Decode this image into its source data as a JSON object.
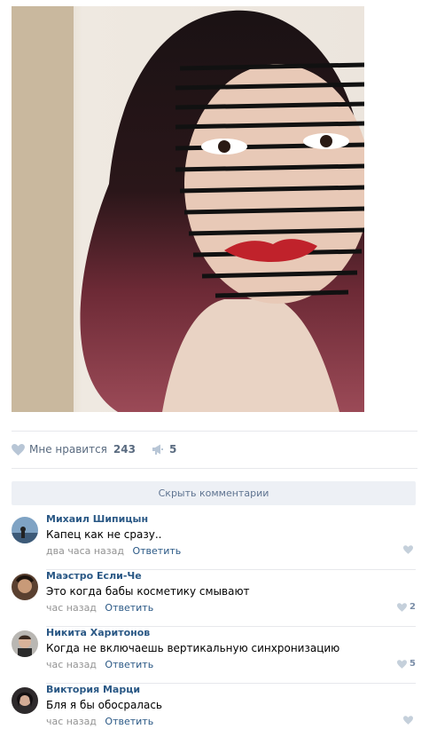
{
  "post": {
    "image": {
      "subject": "optical-illusion-face-makeup"
    },
    "likes": {
      "label": "Мне нравится",
      "count": "243",
      "icon": "heart-icon"
    },
    "shares": {
      "count": "5",
      "icon": "megaphone-icon"
    }
  },
  "comments_section": {
    "hide_label": "Скрыть комментарии",
    "reply_label": "Ответить",
    "items": [
      {
        "author": "Михаил Шипицын",
        "text": "Капец как не сразу..",
        "time": "два часа назад",
        "likes": ""
      },
      {
        "author": "Маэстро Если-Че",
        "text": "Это когда бабы косметику смывают",
        "time": "час назад",
        "likes": "2"
      },
      {
        "author": "Никита Харитонов",
        "text": "Когда не включаешь вертикальную синхронизацию",
        "time": "час назад",
        "likes": "5"
      },
      {
        "author": "Виктория Марци",
        "text": "Бля я бы обосралась",
        "time": "час назад",
        "likes": ""
      }
    ]
  },
  "colors": {
    "link": "#2a5885",
    "muted": "#939393",
    "action": "#5a6b80",
    "button_bg": "#edf0f5"
  }
}
